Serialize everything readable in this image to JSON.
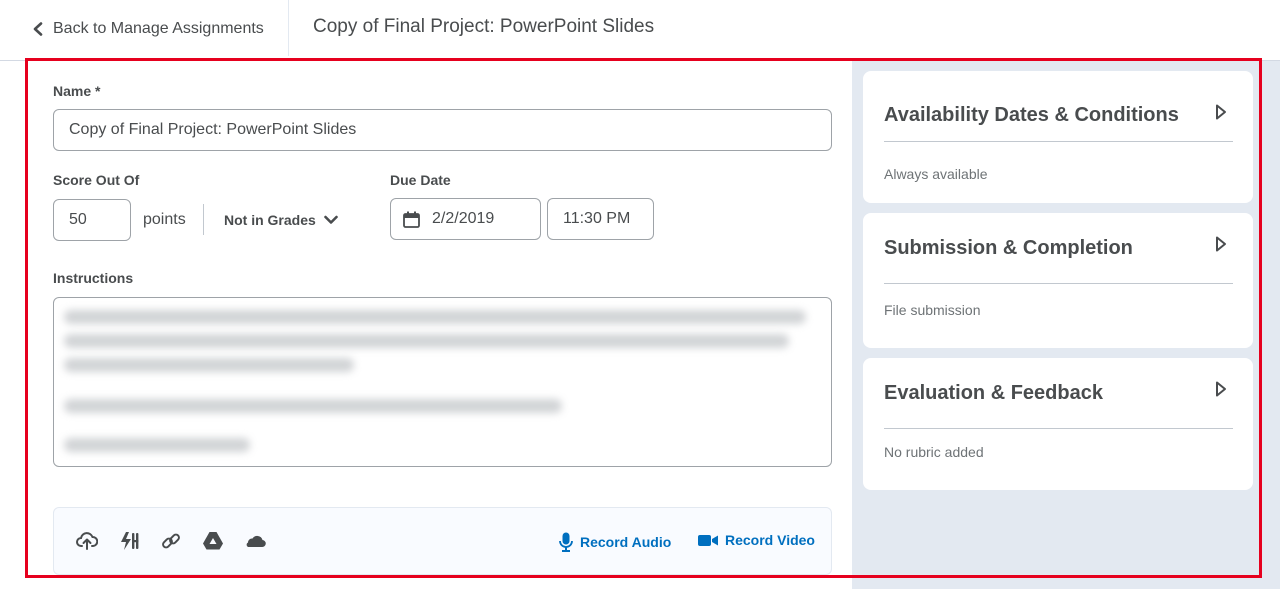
{
  "header": {
    "back_label": "Back to Manage Assignments",
    "title": "Copy of Final Project: PowerPoint Slides"
  },
  "form": {
    "name_label": "Name *",
    "name_value": "Copy of Final Project: PowerPoint Slides",
    "score_label": "Score Out Of",
    "score_value": "50",
    "points_label": "points",
    "grades_label": "Not in Grades",
    "due_label": "Due Date",
    "due_date": "2/2/2019",
    "due_time": "11:30 PM",
    "instructions_label": "Instructions"
  },
  "attachments": {
    "tools": [
      "upload-icon",
      "quicklink-icon",
      "link-icon",
      "google-drive-icon",
      "onedrive-icon"
    ],
    "record_audio": "Record Audio",
    "record_video": "Record Video"
  },
  "sidebar": {
    "cards": [
      {
        "title": "Availability Dates & Conditions",
        "summary": "Always available"
      },
      {
        "title": "Submission & Completion",
        "summary": "File submission"
      },
      {
        "title": "Evaluation & Feedback",
        "summary": "No rubric added"
      }
    ]
  },
  "colors": {
    "accent": "#006fbf",
    "highlight_border": "#e6001e",
    "sidebar_bg": "#e3e9f1"
  }
}
